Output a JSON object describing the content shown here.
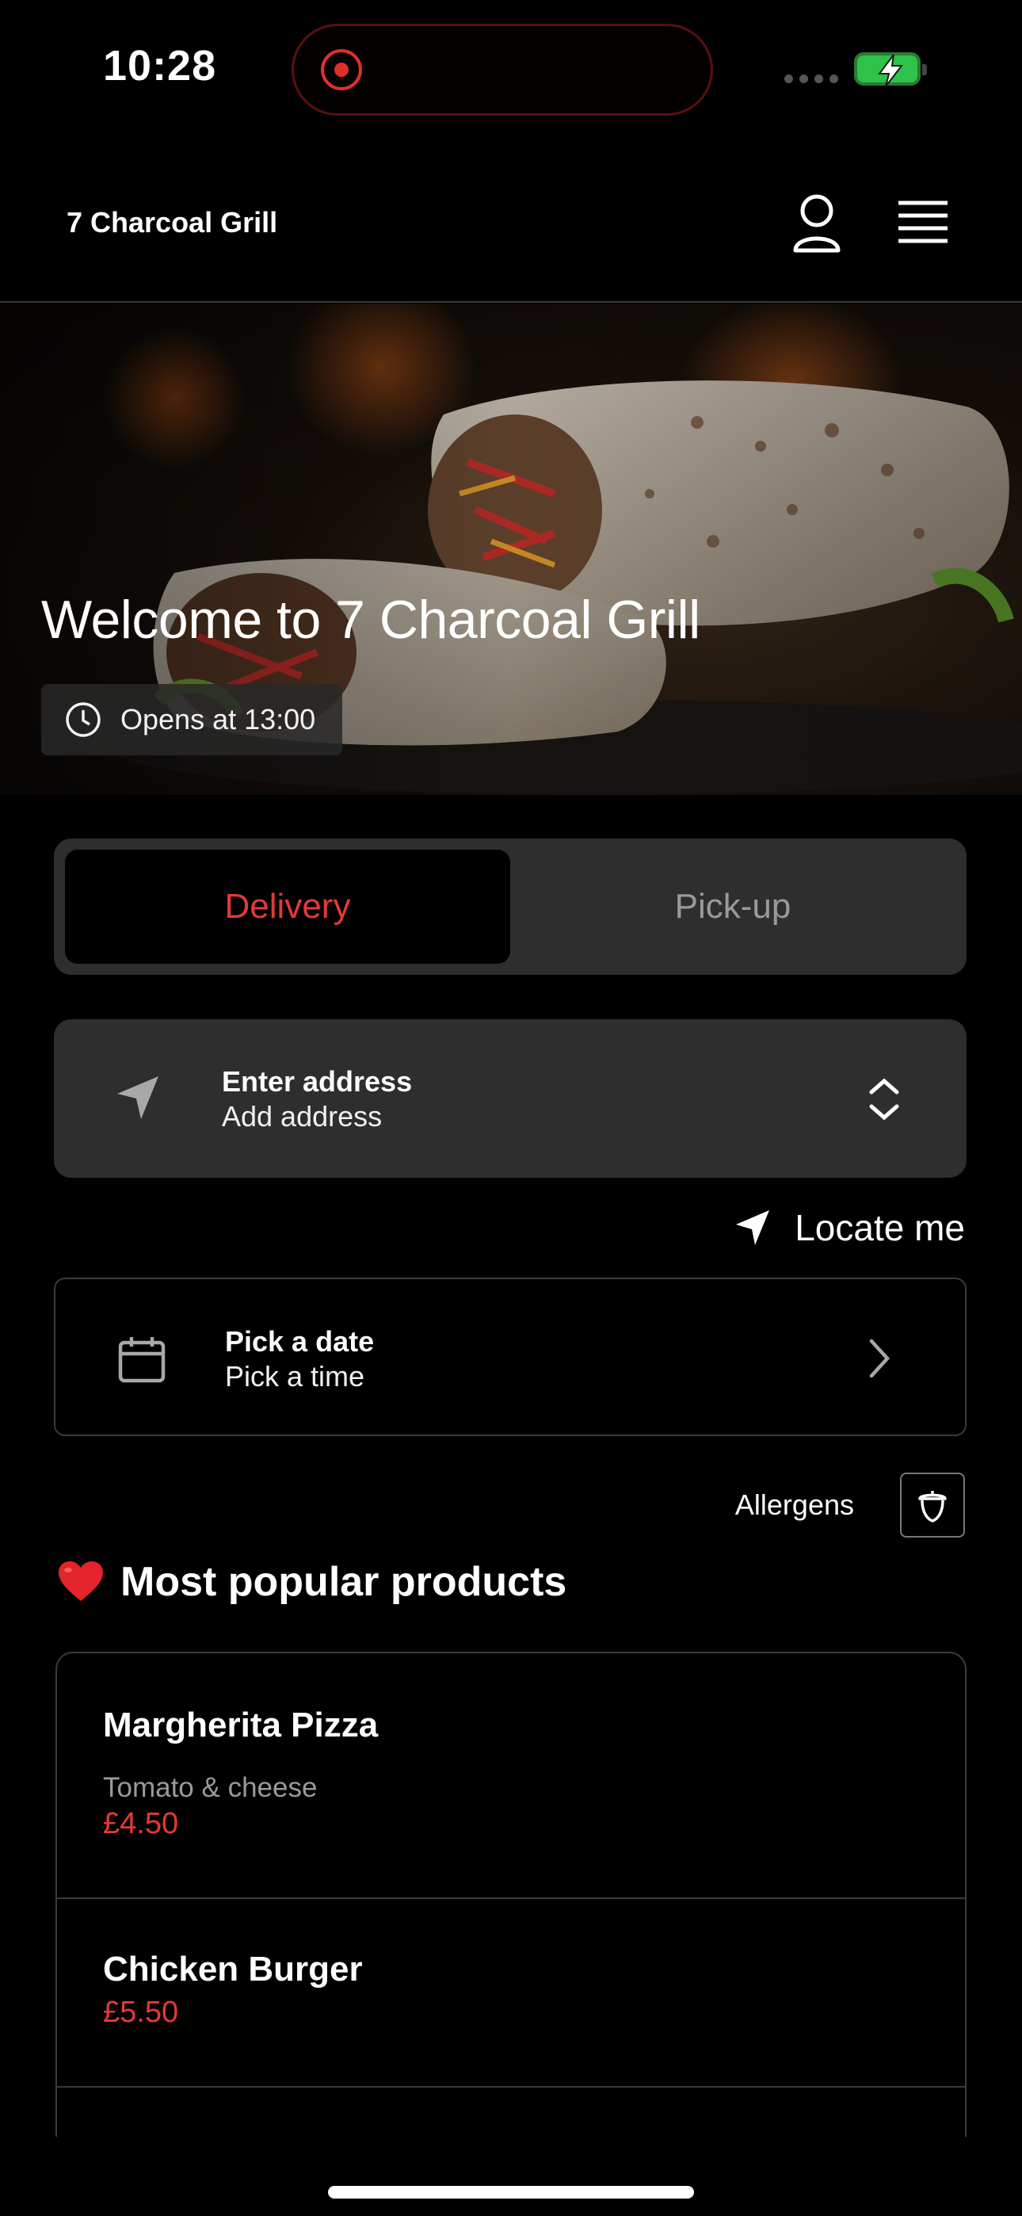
{
  "status_bar": {
    "time": "10:28"
  },
  "header": {
    "brand": "7 Charcoal Grill",
    "profile_icon": "user-icon",
    "menu_icon": "hamburger-menu-icon"
  },
  "hero": {
    "title": "Welcome to 7 Charcoal Grill",
    "hours": "Opens at 13:00",
    "clock_icon": "clock-icon"
  },
  "order_mode": {
    "options": [
      {
        "label": "Delivery",
        "active": true
      },
      {
        "label": "Pick-up",
        "active": false
      }
    ]
  },
  "address": {
    "title": "Enter address",
    "subtitle": "Add address",
    "icon": "location-arrow-icon"
  },
  "locate": {
    "label": "Locate me",
    "icon": "location-arrow-icon"
  },
  "schedule": {
    "title": "Pick a date",
    "subtitle": "Pick a time",
    "icon": "calendar-icon"
  },
  "allergens": {
    "label": "Allergens",
    "icon": "acorn-icon"
  },
  "popular": {
    "emoji": "❤️",
    "title": "Most popular products"
  },
  "products": [
    {
      "name": "Margherita Pizza",
      "description": "Tomato & cheese",
      "price": "£4.50"
    },
    {
      "name": "Chicken Burger",
      "description": "",
      "price": "£5.50"
    }
  ],
  "colors": {
    "accent": "#e53935",
    "background": "#000000",
    "card": "#2e2e2e"
  }
}
